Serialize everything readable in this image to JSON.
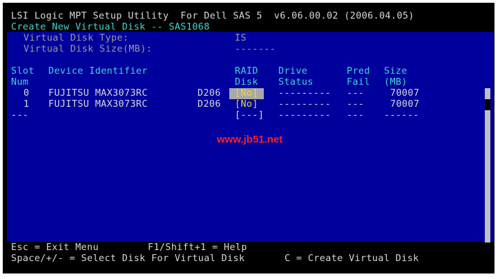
{
  "title": "LSI Logic MPT Setup Utility  For Dell SAS 5  v6.06.00.02 (2006.04.05)",
  "subtitle": "Create New Virtual Disk -- SAS1068",
  "virtual_disk": {
    "type_label": "Virtual Disk Type:",
    "type_value": "IS",
    "size_label": "Virtual Disk Size(MB):",
    "size_value": "-------"
  },
  "columns": {
    "slot": [
      "Slot",
      "Num"
    ],
    "device": [
      "Device Identifier",
      ""
    ],
    "raid": [
      "RAID",
      "Disk"
    ],
    "drive": [
      "Drive",
      "Status"
    ],
    "pred": [
      "Pred",
      "Fail"
    ],
    "size": [
      "Size",
      "(MB)"
    ]
  },
  "rows": [
    {
      "slot": "0",
      "device": "FUJITSU MAX3073RC",
      "rev": "D206",
      "raid": "[No]",
      "status": "---------",
      "pred": "---",
      "size": "70007"
    },
    {
      "slot": "1",
      "device": "FUJITSU MAX3073RC",
      "rev": "D206",
      "raid": "[No]",
      "status": "---------",
      "pred": "---",
      "size": "70007"
    },
    {
      "slot": "---",
      "device": "",
      "rev": "",
      "raid": "[---]",
      "status": "---------",
      "pred": "---",
      "size": "------"
    }
  ],
  "watermark": "www.jb51.net",
  "footer": {
    "line1_left": "Esc = Exit Menu",
    "line1_right": "F1/Shift+1 = Help",
    "line2_left": "Space/+/- = Select Disk For Virtual Disk",
    "line2_right": "C = Create Virtual Disk"
  },
  "colors": {
    "panel": "#00009d",
    "header": "#3fd6d6",
    "highlight": "#a8a8a8",
    "raid_text": "#e8d83a"
  },
  "icons": {
    "scroll_up": "▲",
    "scroll_down": "▼"
  }
}
